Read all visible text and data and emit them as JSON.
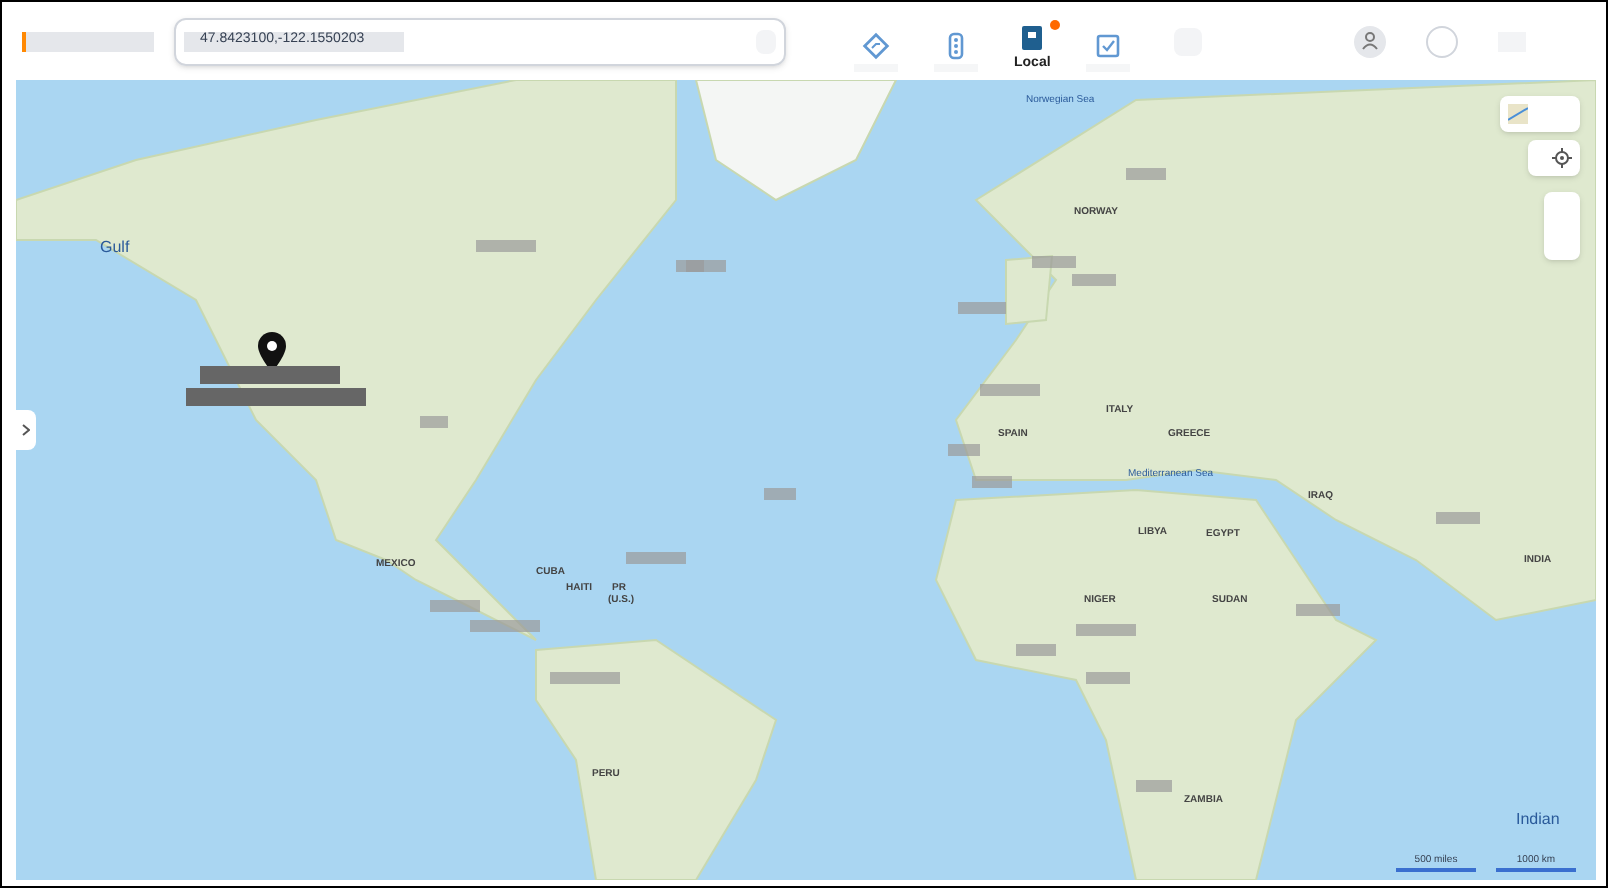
{
  "search": {
    "value": "47.8423100,-122.1550203"
  },
  "toolbar": [
    {
      "kind": "directions",
      "selected": false
    },
    {
      "kind": "traffic",
      "selected": false
    },
    {
      "kind": "local",
      "label": "Local",
      "selected": true,
      "badge": true
    },
    {
      "kind": "saved",
      "selected": false
    }
  ],
  "map": {
    "labels": [
      {
        "text": "Norwegian Sea",
        "kind": "sea"
      },
      {
        "text": "NORWAY",
        "kind": "country"
      },
      {
        "text": "Gulf",
        "kind": "sea"
      },
      {
        "text": "SPAIN",
        "kind": "country"
      },
      {
        "text": "ITALY",
        "kind": "country"
      },
      {
        "text": "GREECE",
        "kind": "country"
      },
      {
        "text": "Mediterranean Sea",
        "kind": "sea"
      },
      {
        "text": "IRAQ",
        "kind": "country"
      },
      {
        "text": "LIBYA",
        "kind": "country"
      },
      {
        "text": "EGYPT",
        "kind": "country"
      },
      {
        "text": "MEXICO",
        "kind": "country"
      },
      {
        "text": "CUBA",
        "kind": "country"
      },
      {
        "text": "HAITI",
        "kind": "country"
      },
      {
        "text": "PR",
        "kind": "country"
      },
      {
        "text": "(U.S.)",
        "kind": "country"
      },
      {
        "text": "NIGER",
        "kind": "country"
      },
      {
        "text": "SUDAN",
        "kind": "country"
      },
      {
        "text": "INDIA",
        "kind": "country"
      },
      {
        "text": "PERU",
        "kind": "country"
      },
      {
        "text": "ZAMBIA",
        "kind": "country"
      },
      {
        "text": "Indian",
        "kind": "sea"
      }
    ],
    "scale": {
      "imperial": "500 miles",
      "metric": "1000 km"
    }
  }
}
